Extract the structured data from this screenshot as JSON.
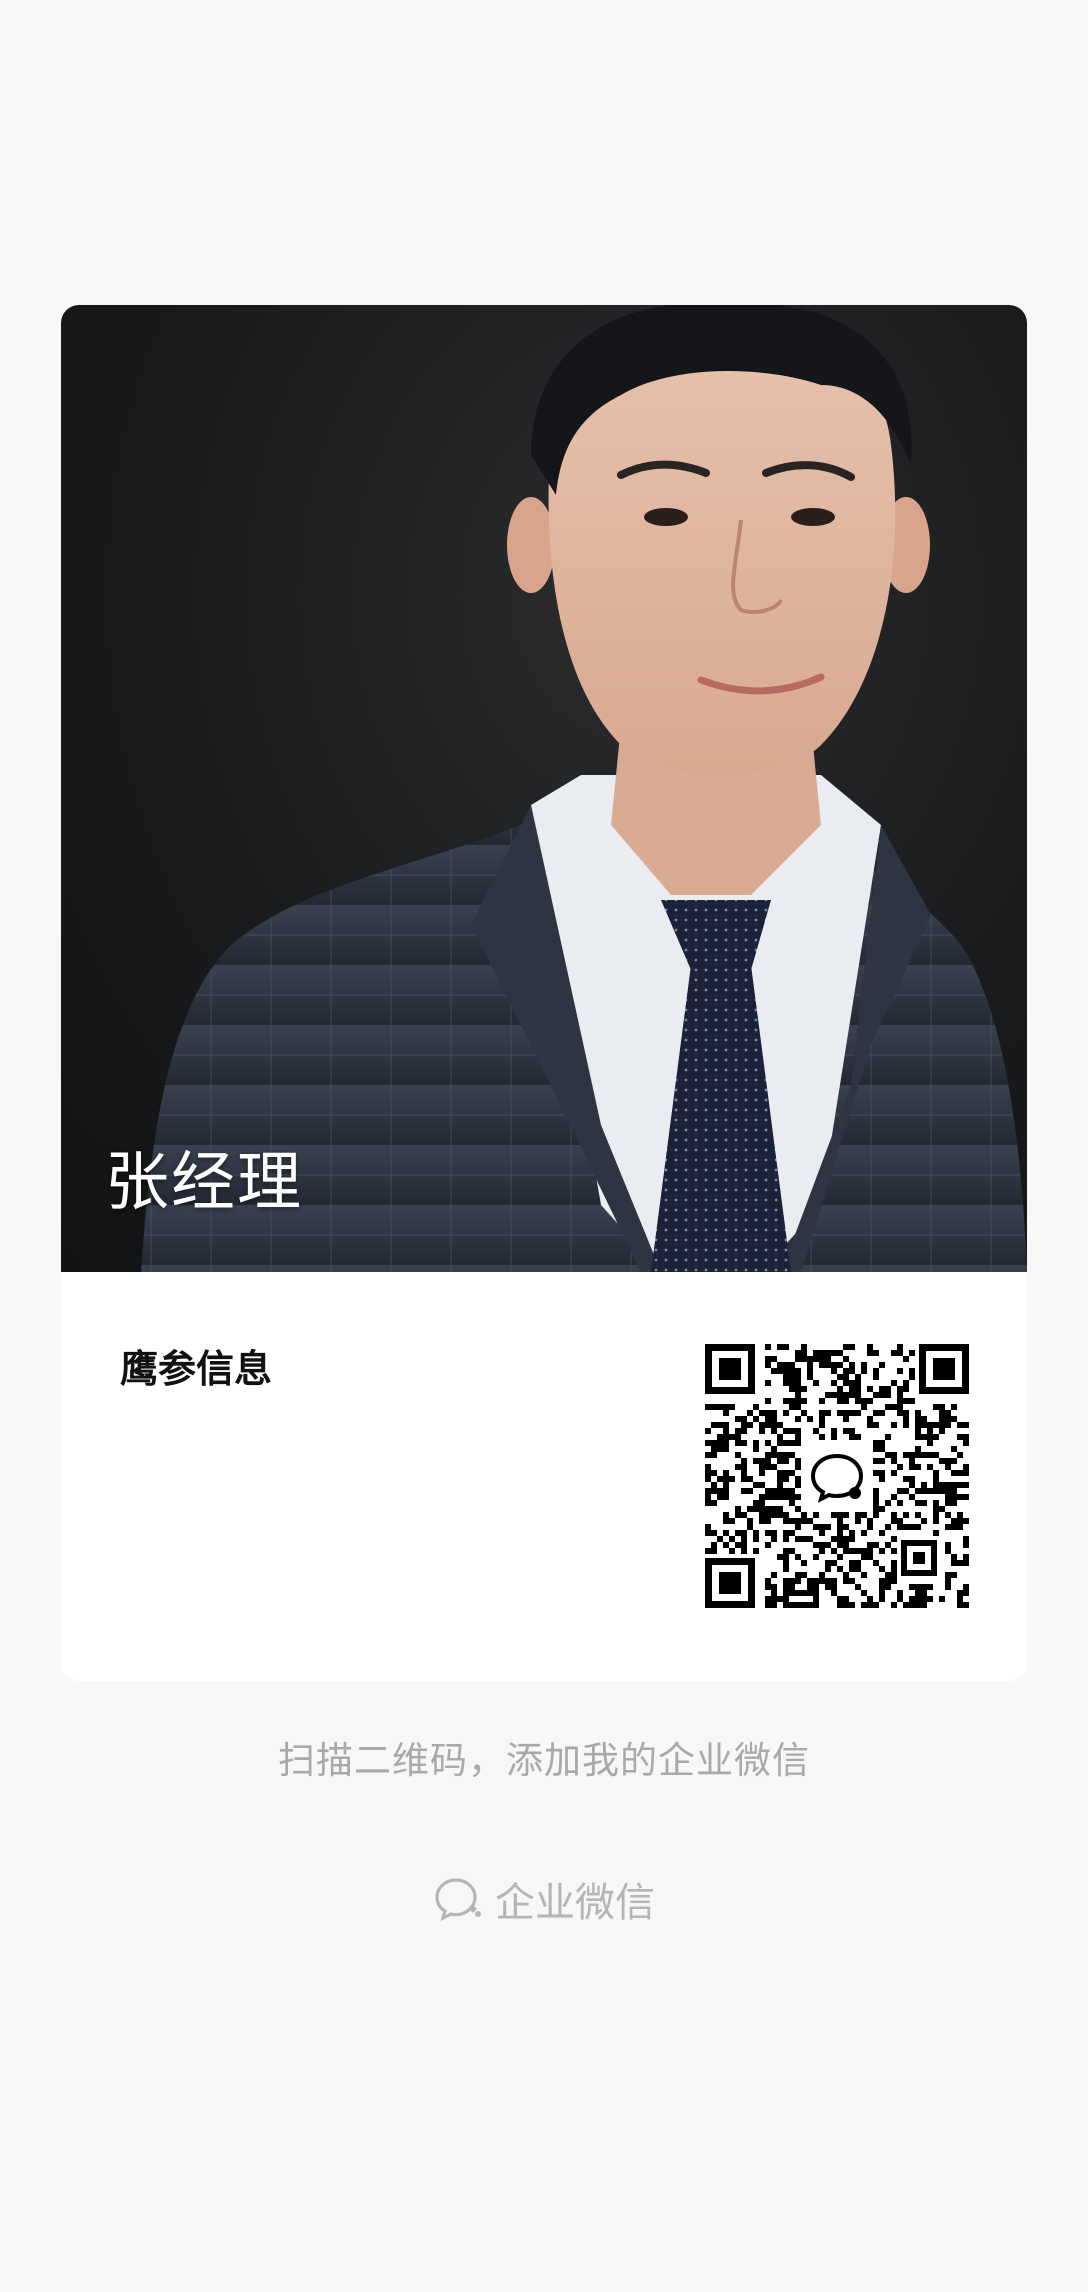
{
  "card": {
    "name": "张经理",
    "company": "鹰参信息",
    "photo_icon": "person-portrait",
    "qr_icon": "qr-code-icon"
  },
  "hint": "扫描二维码，添加我的企业微信",
  "brand": {
    "icon": "wecom-logo-icon",
    "label": "企业微信"
  },
  "colors": {
    "background": "#f7f7f7",
    "card": "#ffffff",
    "hint_text": "#a9a9a9",
    "brand_text": "#b5b5b5"
  }
}
